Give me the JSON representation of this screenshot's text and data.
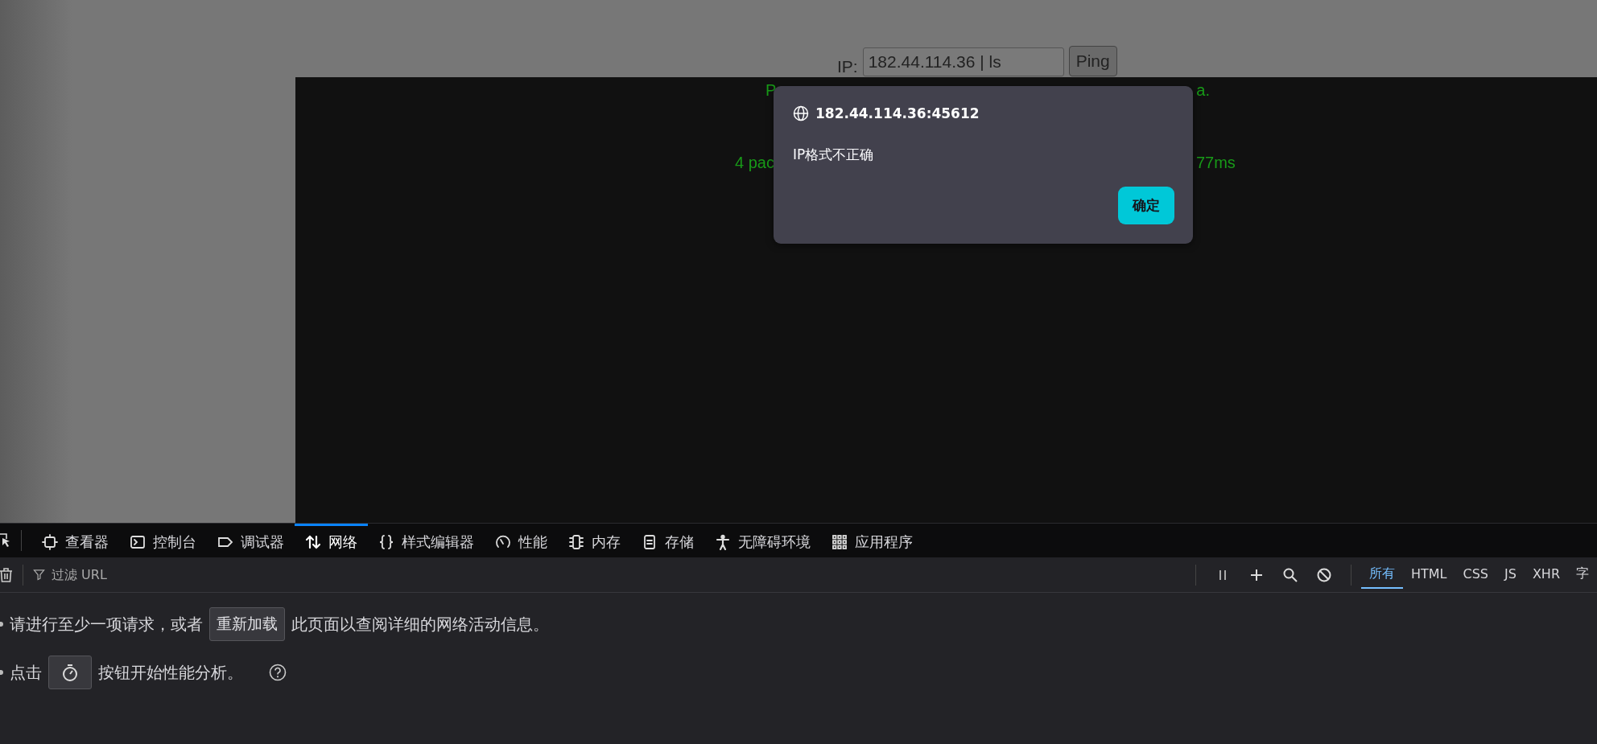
{
  "page": {
    "ip_label": "IP:",
    "ip_field": {
      "value": "182.44.114.36 | ls"
    },
    "ping_button": "Ping",
    "output_lines": [
      {
        "left": "P",
        "right": "a."
      },
      {
        "left": "4 pac",
        "right": "77ms"
      }
    ]
  },
  "dialog": {
    "title": "182.44.114.36:45612",
    "message": "IP格式不正确",
    "ok_button": "确定"
  },
  "devtools": {
    "tabs": [
      {
        "label": "查看器",
        "selected": false
      },
      {
        "label": "控制台",
        "selected": false
      },
      {
        "label": "调试器",
        "selected": false
      },
      {
        "label": "网络",
        "selected": true
      },
      {
        "label": "样式编辑器",
        "selected": false
      },
      {
        "label": "性能",
        "selected": false
      },
      {
        "label": "内存",
        "selected": false
      },
      {
        "label": "存储",
        "selected": false
      },
      {
        "label": "无障碍环境",
        "selected": false
      },
      {
        "label": "应用程序",
        "selected": false
      }
    ],
    "filter": {
      "placeholder": "过滤 URL"
    },
    "type_filters": [
      {
        "label": "所有",
        "selected": true
      },
      {
        "label": "HTML",
        "selected": false
      },
      {
        "label": "CSS",
        "selected": false
      },
      {
        "label": "JS",
        "selected": false
      },
      {
        "label": "XHR",
        "selected": false
      },
      {
        "label": "字",
        "selected": false
      }
    ],
    "messages": [
      {
        "kind": "reload",
        "before": "请进行至少一项请求，或者",
        "button": "重新加载",
        "after": "此页面以查阅详细的网络活动信息。"
      },
      {
        "kind": "perf",
        "before": "点击",
        "after": "按钮开始性能分析。"
      }
    ]
  }
}
